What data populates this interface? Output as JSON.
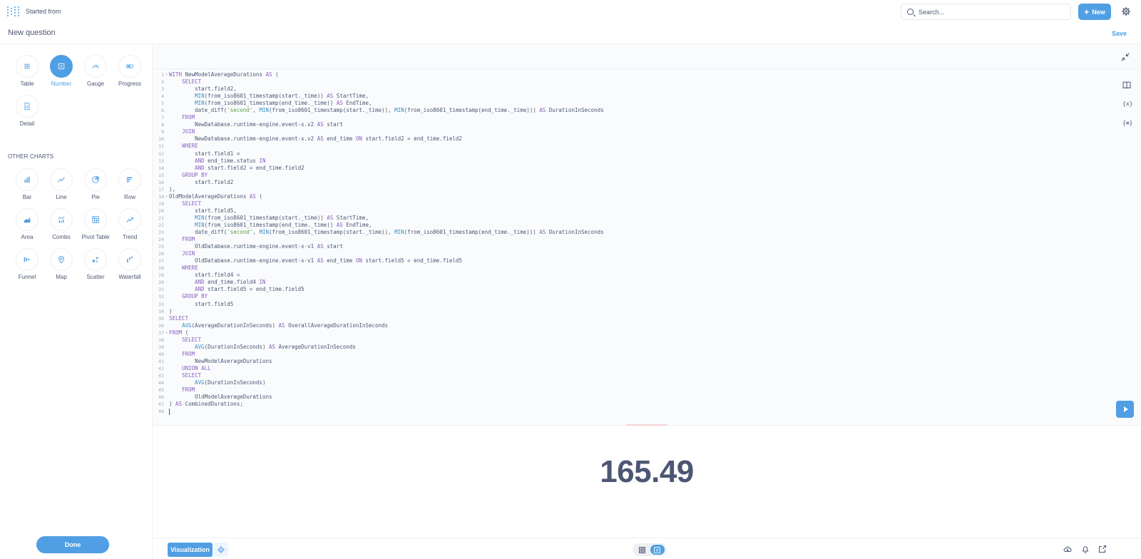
{
  "topbar": {
    "started_from": "Started from",
    "search_placeholder": "Search...",
    "new_label": "New"
  },
  "header": {
    "title": "New question",
    "save_label": "Save"
  },
  "sidebar": {
    "primary": [
      {
        "label": "Table",
        "icon": "table-icon"
      },
      {
        "label": "Number",
        "icon": "number-icon",
        "active": true
      },
      {
        "label": "Gauge",
        "icon": "gauge-icon"
      },
      {
        "label": "Progress",
        "icon": "progress-icon"
      },
      {
        "label": "Detail",
        "icon": "detail-icon"
      }
    ],
    "other_heading": "OTHER CHARTS",
    "other": [
      {
        "label": "Bar",
        "icon": "bar-icon"
      },
      {
        "label": "Line",
        "icon": "line-icon"
      },
      {
        "label": "Pie",
        "icon": "pie-icon"
      },
      {
        "label": "Row",
        "icon": "row-icon"
      },
      {
        "label": "Area",
        "icon": "area-icon"
      },
      {
        "label": "Combo",
        "icon": "combo-icon"
      },
      {
        "label": "Pivot Table",
        "icon": "pivot-table-icon"
      },
      {
        "label": "Trend",
        "icon": "trend-icon"
      },
      {
        "label": "Funnel",
        "icon": "funnel-icon"
      },
      {
        "label": "Map",
        "icon": "map-icon"
      },
      {
        "label": "Scatter",
        "icon": "scatter-icon"
      },
      {
        "label": "Waterfall",
        "icon": "waterfall-icon"
      }
    ],
    "done_label": "Done"
  },
  "editor": {
    "side_icons": [
      "book-icon",
      "variable-icon",
      "snippet-icon"
    ],
    "lines": [
      "WITH NewModelAverageDurations AS (",
      "    SELECT",
      "        start.field2,",
      "        MIN(from_iso8601_timestamp(start._time)) AS StartTime,",
      "        MIN(from_iso8601_timestamp(end_time._time)) AS EndTime,",
      "        date_diff('second', MIN(from_iso8601_timestamp(start._time)), MIN(from_iso8601_timestamp(end_time._time))) AS DurationInSeconds",
      "    FROM",
      "        NewDatabase.runtime-engine.event-x.v2 AS start",
      "    JOIN",
      "        NewDatabase.runtime-engine.event-x.v2 AS end_time ON start.field2 = end_time.field2",
      "    WHERE",
      "        start.field1 =",
      "        AND end_time.status IN",
      "        AND start.field2 = end_time.field2",
      "    GROUP BY",
      "        start.field2",
      "),",
      "OldModelAverageDurations AS (",
      "    SELECT",
      "        start.field5,",
      "        MIN(from_iso8601_timestamp(start._time)) AS StartTime,",
      "        MIN(from_iso8601_timestamp(end_time._time)) AS EndTime,",
      "        date_diff('second', MIN(from_iso8601_timestamp(start._time)), MIN(from_iso8601_timestamp(end_time._time))) AS DurationInSeconds",
      "    FROM",
      "        OldDatabase.runtime-engine.event-x-v1 AS start",
      "    JOIN",
      "        OldDatabase.runtime-engine.event-x-v1 AS end_time ON start.field5 = end_time.field5",
      "    WHERE",
      "        start.field4 =",
      "        AND end_time.field4 IN",
      "        AND start.field5 = end_time.field5",
      "    GROUP BY",
      "        start.field5",
      ")",
      "SELECT",
      "    AVG(AverageDurationInSeconds) AS OverallAverageDurationInSeconds",
      "FROM (",
      "    SELECT",
      "        AVG(DurationInSeconds) AS AverageDurationInSeconds",
      "    FROM",
      "        NewModelAverageDurations",
      "    UNION ALL",
      "    SELECT",
      "        AVG(DurationInSeconds)",
      "    FROM",
      "        OldModelAverageDurations",
      ") AS CombinedDurations;",
      ""
    ],
    "fold_lines": [
      1,
      18,
      37
    ]
  },
  "result": {
    "value": "165.49"
  },
  "footer": {
    "visualization_label": "Visualization"
  },
  "colors": {
    "brand": "#509ee3",
    "text": "#4c5773",
    "keyword": "#8a5fbf",
    "function": "#3c8ec7",
    "string": "#5c9e3c"
  }
}
